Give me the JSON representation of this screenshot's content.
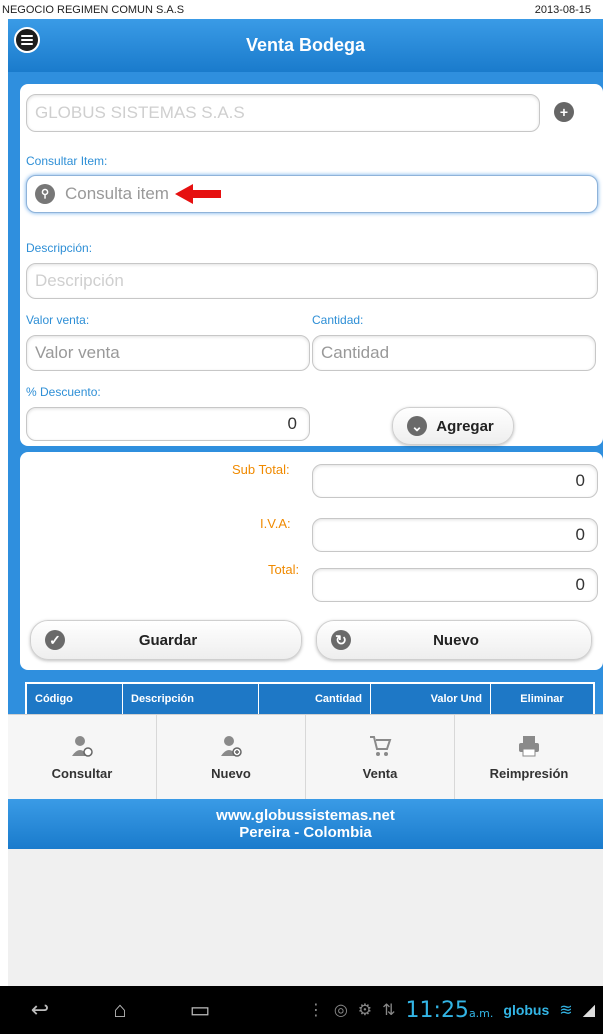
{
  "status": {
    "company": "NEGOCIO REGIMEN COMUN S.A.S",
    "date": "2013-08-15"
  },
  "header": {
    "title": "Venta Bodega",
    "menu_icon": "menu-icon"
  },
  "form": {
    "client_placeholder": "GLOBUS SISTEMAS S.A.S",
    "consult_label": "Consultar Item:",
    "consult_placeholder": "Consulta item",
    "description_label": "Descripción:",
    "description_placeholder": "Descripción",
    "sale_value_label": "Valor venta:",
    "sale_value_placeholder": "Valor venta",
    "quantity_label": "Cantidad:",
    "quantity_placeholder": "Cantidad",
    "discount_label": "% Descuento:",
    "discount_value": "0",
    "add_label": "Agregar"
  },
  "totals": {
    "subtotal_label": "Sub Total:",
    "subtotal_value": "0",
    "iva_label": "I.V.A:",
    "iva_value": "0",
    "total_label": "Total:",
    "total_value": "0",
    "save_label": "Guardar",
    "new_label": "Nuevo"
  },
  "grid": {
    "columns": [
      "Código",
      "Descripción",
      "Cantidad",
      "Valor Und",
      "Eliminar"
    ]
  },
  "tabs": [
    {
      "label": "Consultar",
      "icon": "user-search-icon"
    },
    {
      "label": "Nuevo",
      "icon": "user-add-icon"
    },
    {
      "label": "Venta",
      "icon": "cart-add-icon"
    },
    {
      "label": "Reimpresión",
      "icon": "printer-icon"
    }
  ],
  "footer": {
    "line1": "www.globussistemas.net",
    "line2": "Pereira - Colombia"
  },
  "system": {
    "time": "11:25",
    "ampm": "a.m.",
    "carrier": "globus"
  },
  "colors": {
    "accent": "#2f8fde",
    "label_blue": "#2e8fd6",
    "label_orange": "#f08a00",
    "arrow_red": "#e61010"
  }
}
